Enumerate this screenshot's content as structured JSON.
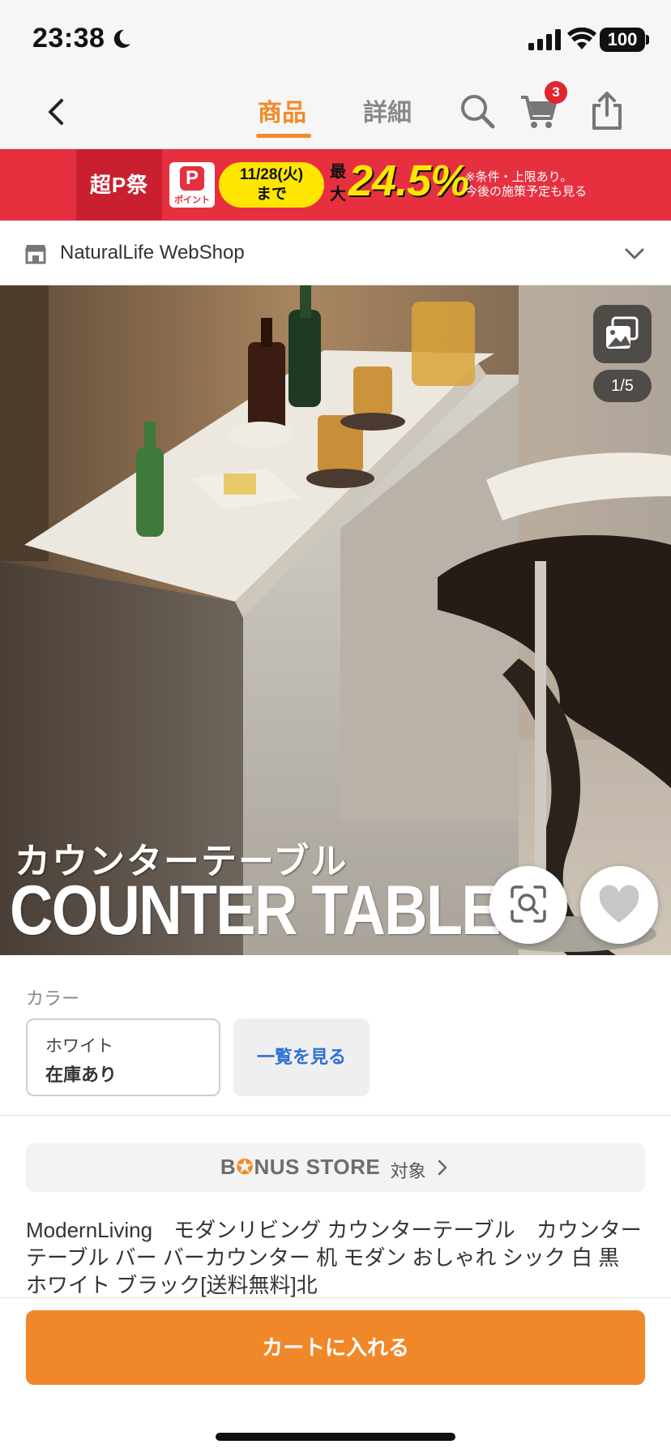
{
  "status_bar": {
    "time": "23:38",
    "battery": "100",
    "icons": [
      "moon-icon",
      "signal-icon",
      "wifi-icon",
      "battery-icon"
    ]
  },
  "header": {
    "tabs": [
      {
        "label": "商品",
        "active": true
      },
      {
        "label": "詳細",
        "active": false
      }
    ],
    "cart_count": "3",
    "icons": [
      "back-icon",
      "search-icon",
      "cart-icon",
      "share-icon"
    ],
    "accent_color": "#f28b29"
  },
  "promo_banner": {
    "logo_text": "超P祭",
    "paypay_label": "ポイント",
    "date_line1": "11/28(火)",
    "date_line2": "まで",
    "max_label": "最大",
    "percentage": "24.5%",
    "note_line1": "※条件・上限あり。",
    "note_line2": "今後の施策予定も見る",
    "background_color": "#e63040",
    "highlight_color": "#ffe600"
  },
  "shop": {
    "name": "NaturalLife WebShop",
    "icon": "store-icon"
  },
  "product_image": {
    "caption_jp": "カウンターテーブル",
    "caption_en": "COUNTER TABLE",
    "counter": "1/5",
    "icons": [
      "gallery-icon",
      "image-search-icon",
      "heart-icon"
    ]
  },
  "color_selection": {
    "label": "カラー",
    "selected_variant": {
      "name": "ホワイト",
      "stock": "在庫あり"
    },
    "see_all_label": "一覧を見る",
    "link_color": "#2b6fd6"
  },
  "bonus_store": {
    "logo": "BONUS STORE",
    "suffix": "対象"
  },
  "product_title": "ModernLiving　モダンリビング カウンターテーブル　カウンター テーブル バー バーカウンター 机 モダン おしゃれ シック 白 黒 ホワイト ブラック[送料無料]北",
  "bottom_bar": {
    "add_to_cart_label": "カートに入れる",
    "button_color": "#f0882a"
  }
}
